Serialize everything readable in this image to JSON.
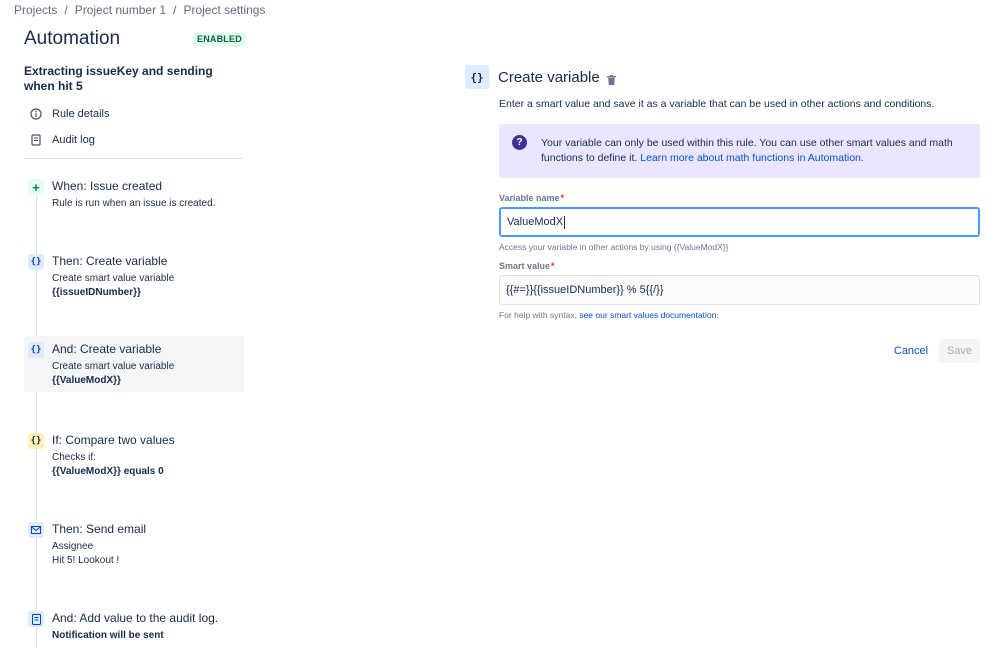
{
  "breadcrumb": [
    "Projects",
    "Project number 1",
    "Project settings"
  ],
  "sidebar": {
    "title": "Automation",
    "status": "ENABLED",
    "rule_name": "Extracting issueKey and sending when hit 5",
    "links": [
      {
        "label": "Rule details",
        "icon": "info-icon"
      },
      {
        "label": "Audit log",
        "icon": "audit-log-icon"
      }
    ]
  },
  "steps": [
    {
      "title": "When: Issue created",
      "desc": "Rule is run when an issue is created.",
      "desc_bold": "",
      "icon": "plus-icon",
      "glyph": "+"
    },
    {
      "title": "Then: Create variable",
      "desc": "Create smart value variable",
      "desc_bold": "{{issueIDNumber}}",
      "icon": "braces-icon",
      "glyph": "{}"
    },
    {
      "title": "And: Create variable",
      "desc": "Create smart value variable",
      "desc_bold": "{{ValueModX}}",
      "icon": "braces-icon",
      "glyph": "{}"
    },
    {
      "title": "If: Compare two values",
      "desc": "Checks if:",
      "desc_bold": "{{ValueModX}} equals 0",
      "icon": "braces-icon",
      "glyph": "{}"
    },
    {
      "title": "Then: Send email",
      "desc": "Assignee",
      "desc2": "Hit 5! Lookout !",
      "icon": "mail-icon"
    },
    {
      "title": "And: Add value to the audit log.",
      "desc": "",
      "desc_bold": "Notification will be sent",
      "icon": "audit-icon"
    }
  ],
  "panel": {
    "icon_glyph": "{}",
    "title": "Create variable",
    "description": "Enter a smart value and save it as a variable that can be used in other actions and conditions.",
    "info_text": "Your variable can only be used within this rule. You can use other smart values and math functions to define it.",
    "info_link": "Learn more about math functions in Automation.",
    "variable_name_label": "Variable name",
    "variable_name_value": "ValueModX",
    "variable_name_helper": "Access your variable in other actions by using {{ValueModX}}",
    "smart_value_label": "Smart value",
    "smart_value_value": "{{#=}}{{issueIDNumber}} % 5{{/}}",
    "smart_value_helper": "For help with syntax,",
    "smart_value_helper_link": "see our smart values documentation.",
    "required_mark": "*",
    "cancel_label": "Cancel",
    "save_label": "Save"
  },
  "colors": {
    "accent": "#0052cc",
    "enabled_badge": "#006644",
    "info_background": "#eae6ff",
    "focus_border": "#4c9aff"
  }
}
